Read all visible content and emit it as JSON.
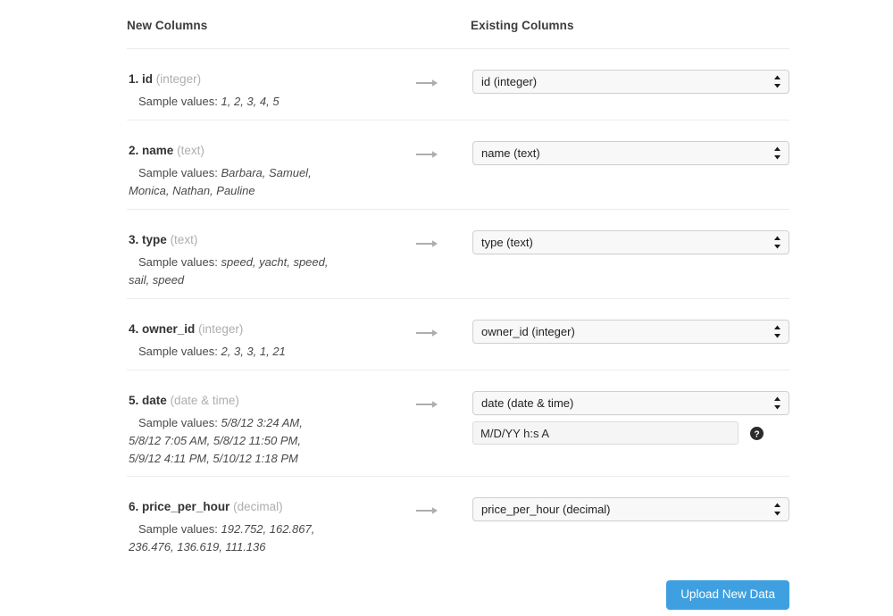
{
  "headers": {
    "new_columns": "New Columns",
    "existing_columns": "Existing Columns"
  },
  "sample_label": "Sample values:",
  "rows": [
    {
      "index": "1.",
      "name": "id",
      "type": "(integer)",
      "sample_values": "1, 2, 3, 4, 5",
      "arrow": "arrow-right-icon",
      "mapped_to": "id (integer)"
    },
    {
      "index": "2.",
      "name": "name",
      "type": "(text)",
      "sample_values": "Barbara, Samuel, Monica, Nathan, Pauline",
      "arrow": "arrow-right-icon",
      "mapped_to": "name (text)"
    },
    {
      "index": "3.",
      "name": "type",
      "type": "(text)",
      "sample_values": "speed, yacht, speed, sail, speed",
      "arrow": "arrow-right-icon",
      "mapped_to": "type (text)"
    },
    {
      "index": "4.",
      "name": "owner_id",
      "type": "(integer)",
      "sample_values": "2, 3, 3, 1, 21",
      "arrow": "arrow-right-icon",
      "mapped_to": "owner_id (integer)"
    },
    {
      "index": "5.",
      "name": "date",
      "type": "(date & time)",
      "sample_values": "5/8/12 3:24 AM, 5/8/12 7:05 AM, 5/8/12 11:50 PM, 5/9/12 4:11 PM, 5/10/12 1:18 PM",
      "arrow": "arrow-right-icon",
      "mapped_to": "date (date & time)",
      "date_format": "M/D/YY h:s A",
      "help_icon": "question-mark-circle-icon"
    },
    {
      "index": "6.",
      "name": "price_per_hour",
      "type": "(decimal)",
      "sample_values": "192.752, 162.867, 236.476, 136.619, 111.136",
      "arrow": "arrow-right-icon",
      "mapped_to": "price_per_hour (decimal)"
    }
  ],
  "footer": {
    "upload_label": "Upload New Data"
  },
  "colors": {
    "accent": "#3ea0e0",
    "divider": "#ececec",
    "muted_text": "#aeaeae",
    "select_bg": "#f8f8f8",
    "input_bg": "#f5f5f5"
  }
}
